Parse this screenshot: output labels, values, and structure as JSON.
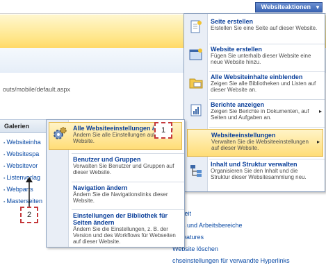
{
  "toolbar": {
    "site_actions_label": "Websiteaktionen"
  },
  "page": {
    "url_fragment": "outs/mobile/default.aspx"
  },
  "galleries": {
    "heading": "Galerien",
    "items": [
      "Websiteinha",
      "Websitespa",
      "Websitevor",
      "Listenvorlag",
      "Webparts",
      "Masterseiten"
    ]
  },
  "bottom_links": [
    "parkeit",
    "sites und Arbeitsbereiche",
    "etefeatures",
    "Website löschen",
    "chseinstellungen für verwandte Hyperlinks"
  ],
  "site_actions_menu": {
    "items": [
      {
        "title": "Seite erstellen",
        "desc": "Erstellen Sie eine Seite auf dieser Website."
      },
      {
        "title": "Website erstellen",
        "desc": "Fügen Sie unterhalb dieser Website eine neue Website hinzu."
      },
      {
        "title": "Alle Websiteinhalte einblenden",
        "desc": "Zeigen Sie alle Bibliotheken und Listen auf dieser Website an."
      },
      {
        "title": "Berichte anzeigen",
        "desc": "Zeigen Sie Berichte in Dokumenten, auf Seiten und Aufgaben an."
      },
      {
        "title": "Websiteeinstellungen",
        "desc": "Verwalten Sie die Websiteeinstellungen auf dieser Website."
      },
      {
        "title": "Inhalt und Struktur verwalten",
        "desc": "Organisieren Sie den Inhalt und die Struktur dieser Websitesammlung neu."
      }
    ]
  },
  "settings_submenu": {
    "items": [
      {
        "title": "Alle Websiteeinstellungen ändern",
        "desc": "Ändern Sie alle Einstellungen auf dieser Website."
      },
      {
        "title": "Benutzer und Gruppen",
        "desc": "Verwalten Sie Benutzer und Gruppen auf dieser Website."
      },
      {
        "title": "Navigation ändern",
        "desc": "Ändern Sie die Navigationslinks dieser Website."
      },
      {
        "title": "Einstellungen der Bibliothek für Seiten ändern",
        "desc": "Ändern Sie die Einstellungen, z. B. der Version und des Workflows für Webseiten auf dieser Website."
      }
    ]
  },
  "callouts": {
    "one": "1",
    "two": "2"
  },
  "colors": {
    "link": "#0a3f9a",
    "highlight": "#ffdd77",
    "menu_border": "#8ea3c0",
    "callout": "#c4373a"
  }
}
